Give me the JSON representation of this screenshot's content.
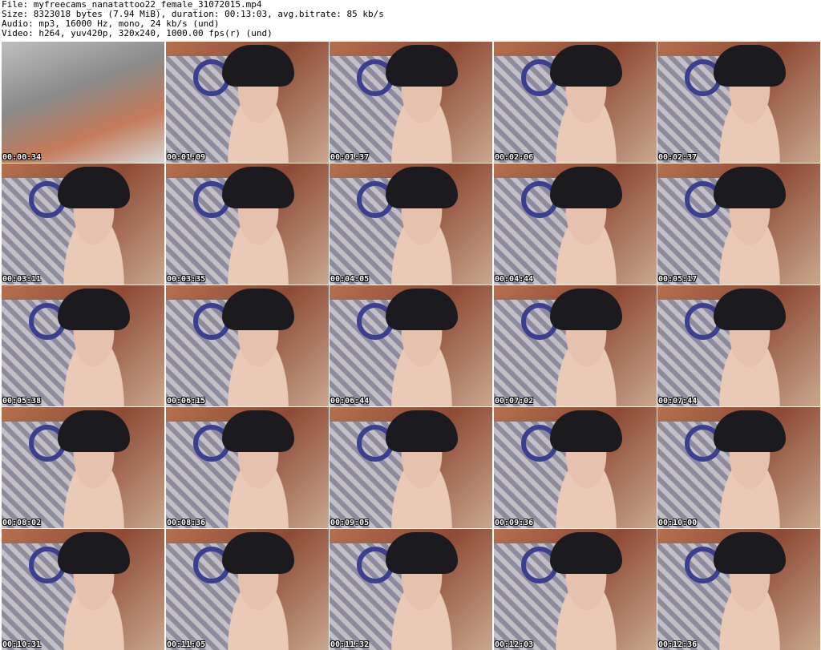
{
  "header": {
    "file": "File: myfreecams_nanatattoo22_female_31072015.mp4",
    "size": "Size: 8323018 bytes (7.94 MiB), duration: 00:13:03, avg.bitrate: 85 kb/s",
    "audio": "Audio: mp3, 16000 Hz, mono, 24 kb/s (und)",
    "video": "Video: h264, yuv420p, 320x240, 1000.00 fps(r) (und)"
  },
  "thumbnails": [
    {
      "timestamp": "00:00:34"
    },
    {
      "timestamp": "00:01:09"
    },
    {
      "timestamp": "00:01:37"
    },
    {
      "timestamp": "00:02:06"
    },
    {
      "timestamp": "00:02:37"
    },
    {
      "timestamp": "00:03:11"
    },
    {
      "timestamp": "00:03:35"
    },
    {
      "timestamp": "00:04:05"
    },
    {
      "timestamp": "00:04:44"
    },
    {
      "timestamp": "00:05:17"
    },
    {
      "timestamp": "00:05:38"
    },
    {
      "timestamp": "00:06:15"
    },
    {
      "timestamp": "00:06:44"
    },
    {
      "timestamp": "00:07:02"
    },
    {
      "timestamp": "00:07:44"
    },
    {
      "timestamp": "00:08:02"
    },
    {
      "timestamp": "00:08:36"
    },
    {
      "timestamp": "00:09:05"
    },
    {
      "timestamp": "00:09:36"
    },
    {
      "timestamp": "00:10:00"
    },
    {
      "timestamp": "00:10:31"
    },
    {
      "timestamp": "00:11:05"
    },
    {
      "timestamp": "00:11:32"
    },
    {
      "timestamp": "00:12:03"
    },
    {
      "timestamp": "00:12:36"
    }
  ]
}
